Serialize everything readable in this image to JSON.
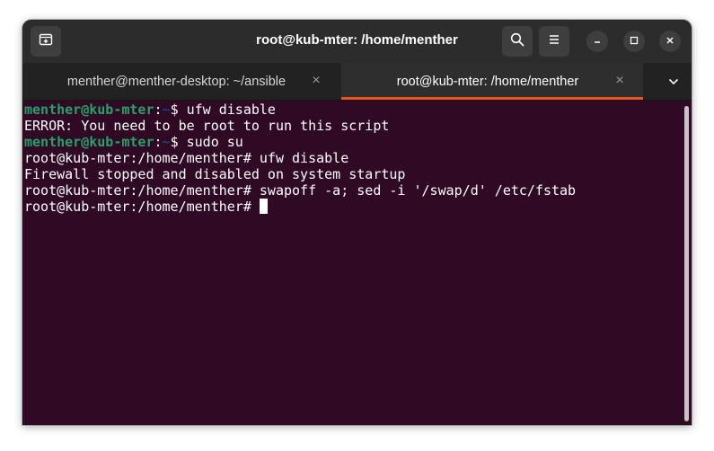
{
  "window": {
    "title": "root@kub-mter: /home/menther"
  },
  "tabs": [
    {
      "label": "menther@menther-desktop: ~/ansible",
      "active": false
    },
    {
      "label": "root@kub-mter: /home/menther",
      "active": true
    }
  ],
  "terminal": {
    "lines": [
      {
        "user": "menther@kub-mter",
        "sep": ":",
        "path": "~",
        "text": "$ ufw disable"
      },
      {
        "text": "ERROR: You need to be root to run this script"
      },
      {
        "user": "menther@kub-mter",
        "sep": ":",
        "path": "~",
        "text": "$ sudo su"
      },
      {
        "text": "root@kub-mter:/home/menther# ufw disable"
      },
      {
        "text": "Firewall stopped and disabled on system startup"
      },
      {
        "text": "root@kub-mter:/home/menther# swapoff -a; sed -i '/swap/d' /etc/fstab"
      },
      {
        "text": "root@kub-mter:/home/menther# "
      }
    ]
  },
  "icons": {
    "new_tab": "new-tab-icon",
    "search": "search-icon",
    "menu": "hamburger-menu-icon",
    "minimize": "minimize-icon",
    "maximize": "maximize-icon",
    "close": "close-icon",
    "tabs_dropdown": "chevron-down-icon"
  },
  "colors": {
    "terminal_bg": "#300a24",
    "prompt_user": "#26a269",
    "prompt_path": "#12488b",
    "active_tab_indicator": "#e95420",
    "headerbar_bg": "#2c2c2c"
  }
}
